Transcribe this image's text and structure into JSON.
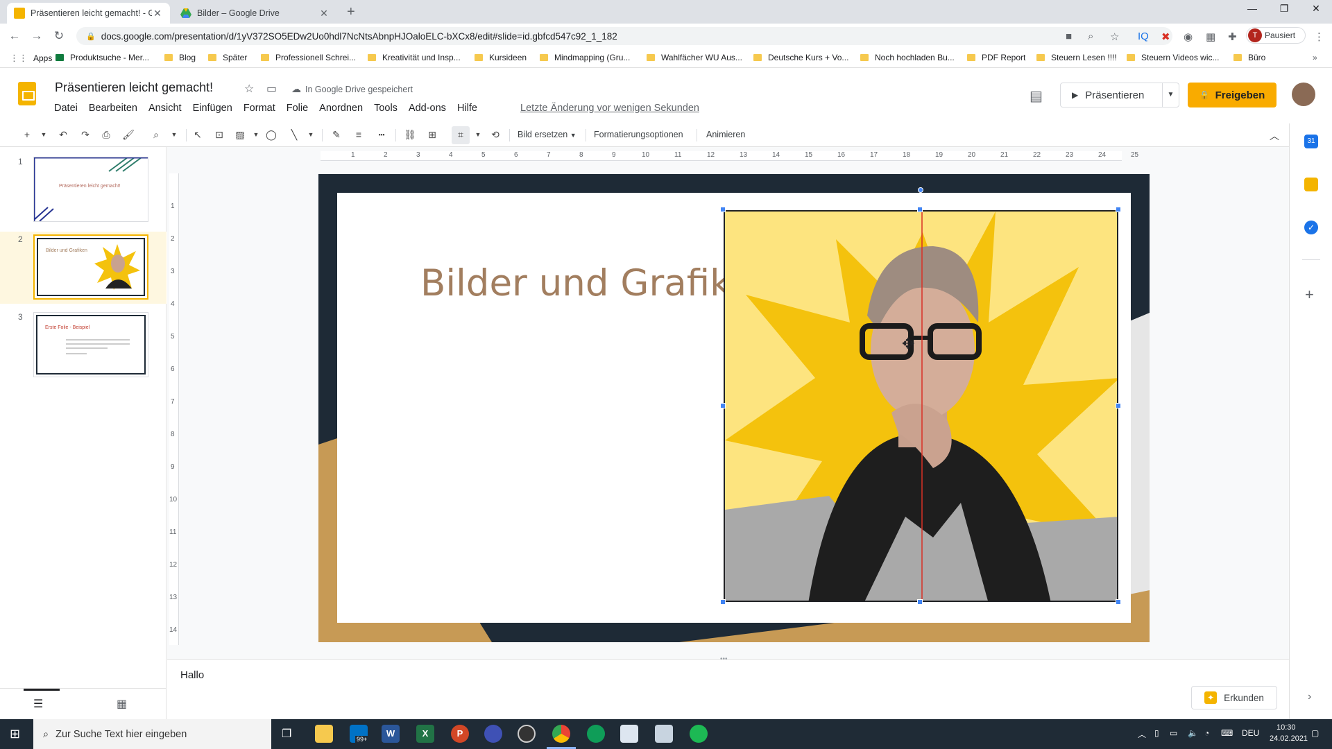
{
  "browser": {
    "tabs": [
      {
        "title": "Präsentieren leicht gemacht! - G",
        "active": true
      },
      {
        "title": "Bilder – Google Drive",
        "active": false
      }
    ],
    "new_tab": "+",
    "url": "docs.google.com/presentation/d/1yV372SO5EDw2Uo0hdl7NcNtsAbnpHJOaloELC-bXCx8/edit#slide=id.gbfcd547c92_1_182",
    "profile_initial": "T",
    "profile_label": "Pausiert",
    "bookmarks": [
      "Apps",
      "Produktsuche - Mer...",
      "Blog",
      "Später",
      "Professionell Schrei...",
      "Kreativität und Insp...",
      "Kursideen",
      "Mindmapping (Gru...",
      "Wahlfächer WU Aus...",
      "Deutsche Kurs + Vo...",
      "Noch hochladen Bu...",
      "PDF Report",
      "Steuern Lesen !!!!",
      "Steuern Videos wic...",
      "Büro"
    ]
  },
  "app": {
    "title": "Präsentieren leicht gemacht!",
    "saved_status": "In Google Drive gespeichert",
    "menu": [
      "Datei",
      "Bearbeiten",
      "Ansicht",
      "Einfügen",
      "Format",
      "Folie",
      "Anordnen",
      "Tools",
      "Add-ons",
      "Hilfe"
    ],
    "last_edit": "Letzte Änderung vor wenigen Sekunden",
    "present_label": "Präsentieren",
    "share_label": "Freigeben"
  },
  "toolbar": {
    "replace_image": "Bild ersetzen",
    "format_options": "Formatierungsoptionen",
    "animate": "Animieren"
  },
  "filmstrip": {
    "slides": [
      {
        "num": "1",
        "title": "Präsentieren leicht gemacht!"
      },
      {
        "num": "2",
        "title": "Bilder und Grafiken"
      },
      {
        "num": "3",
        "title": "Erste Folie - Beispiel"
      }
    ]
  },
  "ruler": {
    "h": [
      "1",
      "2",
      "3",
      "4",
      "5",
      "6",
      "7",
      "8",
      "9",
      "10",
      "11",
      "12",
      "13",
      "14",
      "15",
      "16",
      "17",
      "18",
      "19",
      "20",
      "21",
      "22",
      "23",
      "24",
      "25"
    ],
    "v": [
      "1",
      "2",
      "3",
      "4",
      "5",
      "6",
      "7",
      "8",
      "9",
      "10",
      "11",
      "12",
      "13",
      "14"
    ]
  },
  "slide": {
    "title": "Bilder und Grafiken"
  },
  "notes": {
    "text": "Hallo",
    "explore_label": "Erkunden"
  },
  "taskbar": {
    "search_placeholder": "Zur Suche Text hier eingeben",
    "mail_badge": "99+",
    "language": "DEU",
    "time": "10:30",
    "date": "24.02.2021"
  },
  "colors": {
    "accent": "#f9ab00",
    "slide_title": "#a27e5f",
    "selection": "#4285f4",
    "guide": "#d93025"
  }
}
